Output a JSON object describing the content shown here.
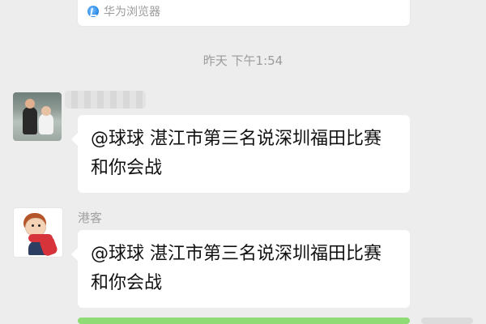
{
  "top_card": {
    "source": "华为浏览器",
    "source_icon": "browser-icon"
  },
  "timestamp": "昨天 下午1:54",
  "messages": [
    {
      "sender": "",
      "avatar_icon": "avatar-photo",
      "text": "@球球  湛江市第三名说深圳福田比赛和你会战"
    },
    {
      "sender": "港客",
      "avatar_icon": "avatar-cartoon",
      "text": "@球球  湛江市第三名说深圳福田比赛和你会战"
    }
  ],
  "colors": {
    "background": "#ededed",
    "bubble": "#ffffff",
    "timestamp_text": "#9b9b9b",
    "accent_green": "#8fdb75"
  }
}
